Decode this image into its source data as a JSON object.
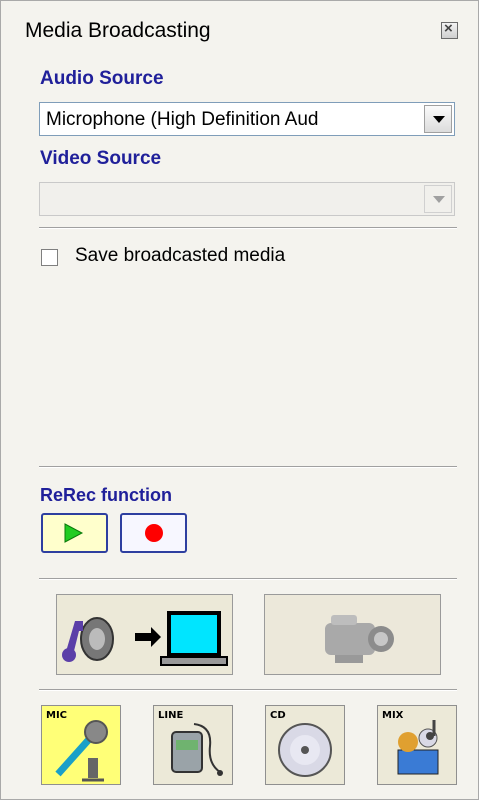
{
  "window": {
    "title": "Media Broadcasting"
  },
  "audio": {
    "label": "Audio Source",
    "value": "Microphone (High Definition Aud"
  },
  "video": {
    "label": "Video Source",
    "value": ""
  },
  "save": {
    "label": "Save broadcasted media",
    "checked": false
  },
  "rerec": {
    "label": "ReRec function"
  },
  "sources": {
    "mic": "MIC",
    "line": "LINE",
    "cd": "CD",
    "mix": "MIX",
    "active": "MIC"
  },
  "colors": {
    "label_blue": "#20209a",
    "play_bg": "#ffffcc",
    "active_source": "#ffff77",
    "record_red": "#ff0000"
  }
}
